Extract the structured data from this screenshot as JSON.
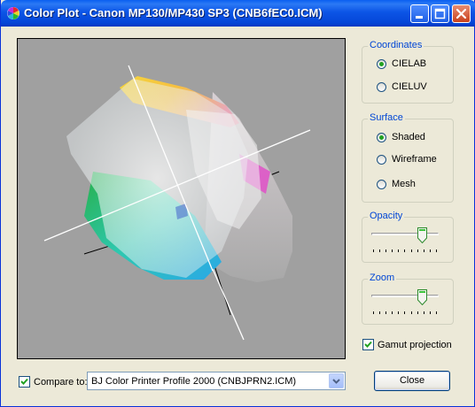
{
  "window": {
    "title": "Color Plot - Canon MP130/MP430 SP3 (CNB6fEC0.ICM)",
    "title_icon": "color-wheel-icon",
    "controls": [
      "minimize-icon",
      "maximize-icon",
      "close-icon"
    ]
  },
  "coordinates": {
    "legend": "Coordinates",
    "options": [
      "CIELAB",
      "CIELUV"
    ],
    "selected": "CIELAB"
  },
  "surface": {
    "legend": "Surface",
    "options": [
      "Shaded",
      "Wireframe",
      "Mesh"
    ],
    "selected": "Shaded"
  },
  "opacity": {
    "legend": "Opacity",
    "value_fraction": 0.75
  },
  "zoom": {
    "legend": "Zoom",
    "value_fraction": 0.75
  },
  "gamut_projection": {
    "label": "Gamut projection",
    "checked": true
  },
  "compare": {
    "label": "Compare to:",
    "checked": true,
    "selected_profile": "BJ Color Printer Profile 2000 (CNBJPRN2.ICM)"
  },
  "close_button": {
    "label": "Close"
  },
  "colors": {
    "title_bar": "#0546d8",
    "group_title": "#0046d5",
    "plot_bg": "#a0a0a0"
  }
}
